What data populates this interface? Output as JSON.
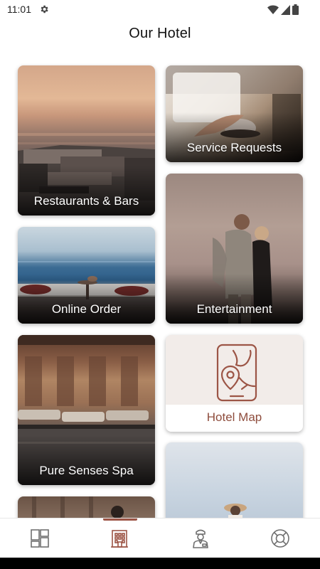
{
  "status_bar": {
    "time": "11:01",
    "icons": [
      "gear-icon",
      "wifi-icon",
      "signal-icon",
      "battery-icon"
    ]
  },
  "header": {
    "title": "Our Hotel"
  },
  "tiles": [
    {
      "label": "Restaurants & Bars"
    },
    {
      "label": "Service Requests"
    },
    {
      "label": "Online Order"
    },
    {
      "label": "Entertainment"
    },
    {
      "label": "Pure Senses Spa"
    },
    {
      "label": "Hotel Map",
      "icon": "map-phone-pin-icon"
    }
  ],
  "bottom_nav": {
    "items": [
      {
        "icon": "tiles-grid-icon",
        "active": false
      },
      {
        "icon": "hotel-building-icon",
        "active": true
      },
      {
        "icon": "concierge-icon",
        "active": false
      },
      {
        "icon": "lifebuoy-icon",
        "active": false
      }
    ]
  },
  "colors": {
    "accent": "#9c5546",
    "map_tile_background": "#f2ece9",
    "icon_gray": "#6f6f6f"
  }
}
